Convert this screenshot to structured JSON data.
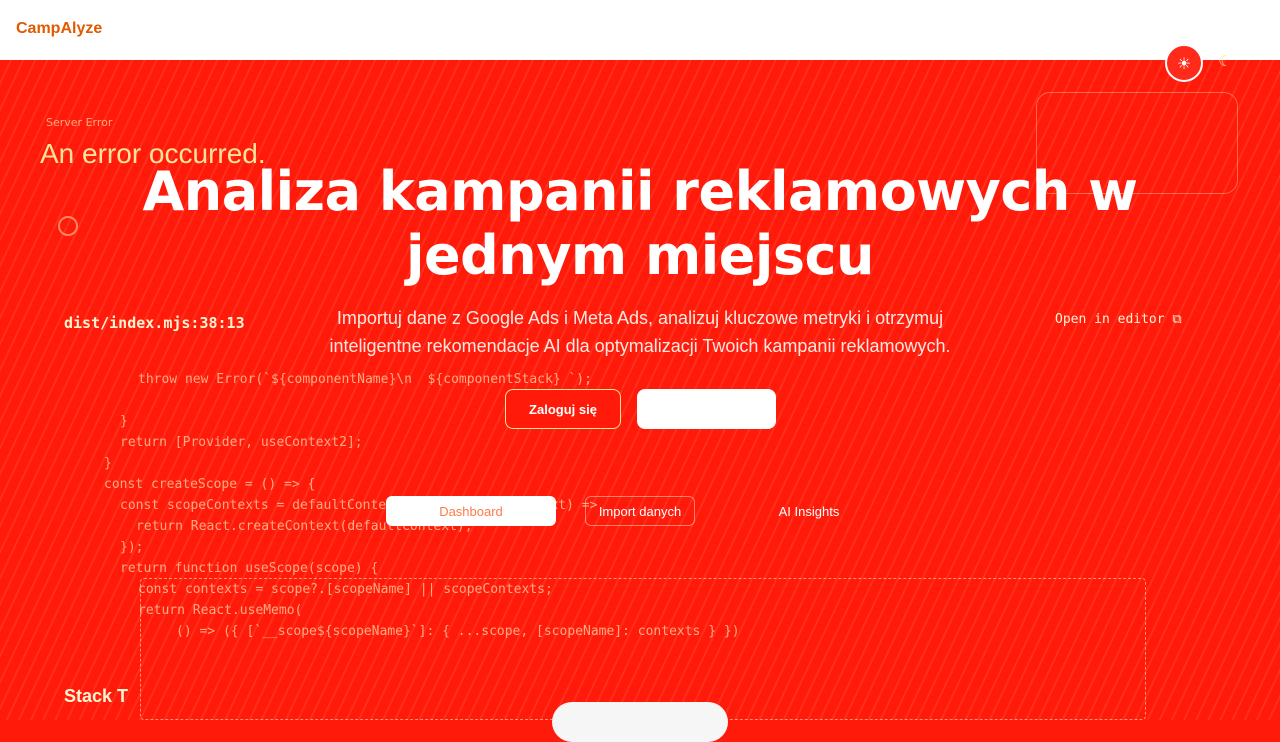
{
  "header": {
    "brand": "CampAlyze",
    "theme_icon": "sun-icon",
    "moon_icon": "moon-icon"
  },
  "error_overlay": {
    "label": "Server Error",
    "title": "An error occurred.",
    "file_ref": "dist/index.mjs:38:13",
    "open_in_editor": "Open in editor",
    "stack_title": "Stack T",
    "code_lines": [
      "throw new Error(`${componentName}\\n  ${componentStack} `);",
      "}",
      "return [Provider, useContext2];",
      "}",
      "const createScope = () => {",
      "const scopeContexts = defaultContexts.map((defaultContext) =>",
      "return React.createContext(defaultContext);",
      "});",
      "return function useScope(scope) {",
      "const contexts = scope?.[scopeName] || scopeContexts;",
      "return React.useMemo(",
      "() => ({ [`__scope${scopeName}`]: { ...scope, [scopeName]: contexts } })"
    ]
  },
  "hero": {
    "title": "Analiza kampanii reklamowych w jednym miejscu",
    "description": "Importuj dane z Google Ads i Meta Ads, analizuj kluczowe metryki i otrzymuj inteligentne rekomendacje AI dla optymalizacji Twoich kampanii reklamowych.",
    "login_label": "Zaloguj się",
    "register_label": ""
  },
  "tabs": [
    {
      "label": "Dashboard"
    },
    {
      "label": "Import danych"
    },
    {
      "label": "AI Insights"
    }
  ],
  "colors": {
    "background": "#ff1a0a",
    "brand": "#e05a00",
    "white": "#ffffff"
  }
}
